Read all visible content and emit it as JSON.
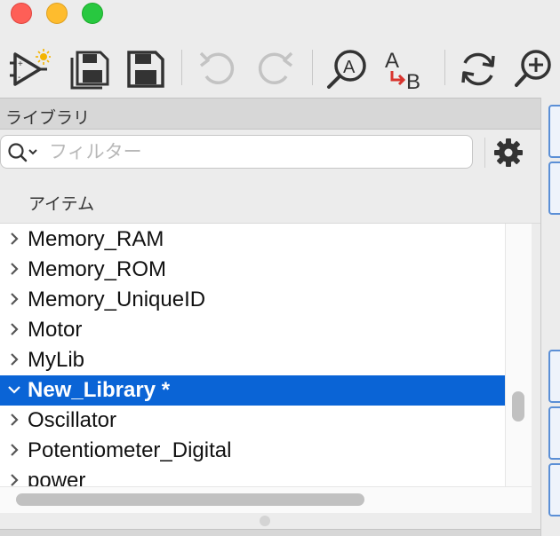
{
  "window": {
    "traffic_lights": {
      "close": "#fe5f57",
      "minimize": "#febc2e",
      "maximize": "#28c840"
    }
  },
  "toolbar": {
    "buttons": [
      {
        "name": "new-symbol-button",
        "icon": "new-symbol-icon"
      },
      {
        "name": "save-all-button",
        "icon": "save-all-icon"
      },
      {
        "name": "save-button",
        "icon": "save-icon"
      },
      {
        "name": "undo-button",
        "icon": "undo-icon",
        "enabled": false
      },
      {
        "name": "redo-button",
        "icon": "redo-icon",
        "enabled": false
      },
      {
        "name": "find-text-button",
        "icon": "find-icon"
      },
      {
        "name": "replace-text-button",
        "icon": "replace-icon"
      },
      {
        "name": "refresh-button",
        "icon": "refresh-icon"
      },
      {
        "name": "zoom-in-button",
        "icon": "zoom-in-icon"
      }
    ]
  },
  "library_panel": {
    "title": "ライブラリ",
    "filter": {
      "placeholder": "フィルター",
      "value": ""
    },
    "column_header": "アイテム",
    "accent_color": "#0a64d6",
    "items": [
      {
        "label": "Memory_RAM",
        "expanded": false,
        "selected": false
      },
      {
        "label": "Memory_ROM",
        "expanded": false,
        "selected": false
      },
      {
        "label": "Memory_UniqueID",
        "expanded": false,
        "selected": false
      },
      {
        "label": "Motor",
        "expanded": false,
        "selected": false
      },
      {
        "label": "MyLib",
        "expanded": false,
        "selected": false
      },
      {
        "label": "New_Library *",
        "expanded": true,
        "selected": true
      },
      {
        "label": "Oscillator",
        "expanded": false,
        "selected": false
      },
      {
        "label": "Potentiometer_Digital",
        "expanded": false,
        "selected": false
      },
      {
        "label": "power",
        "expanded": false,
        "selected": false
      }
    ]
  }
}
